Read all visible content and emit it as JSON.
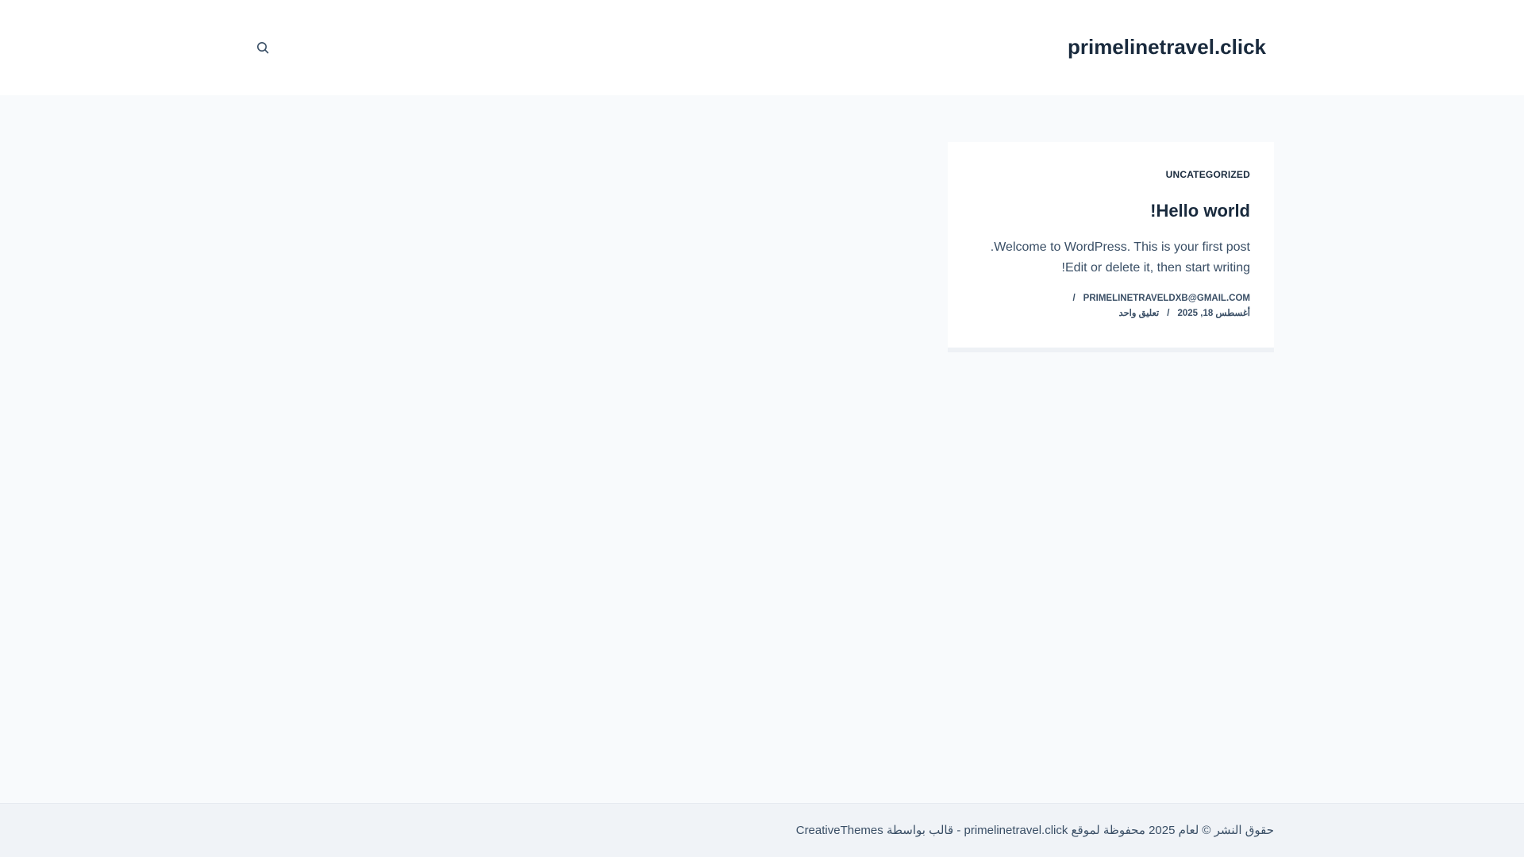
{
  "header": {
    "site_title": "primelinetravel.click",
    "search_icon": "search-icon"
  },
  "post": {
    "category": "UNCATEGORIZED",
    "title": "Hello world!",
    "excerpt_line1": "Welcome to WordPress. This is your first post.",
    "excerpt_line2": "Edit or delete it, then start writing!",
    "author": "PRIMELINETRAVELDXB@GMAIL.COM",
    "date": "أغسطس 18, 2025",
    "comments": "تعليق واحد",
    "separator": "/"
  },
  "footer": {
    "copyright": "حقوق النشر © لعام 2025 محفوظة لموقع primelinetravel.click - قالب بواسطة CreativeThemes"
  },
  "colors": {
    "page_bg": "#f8fafc",
    "header_bg": "#ffffff",
    "heading": "#192a3d",
    "text": "#3a4f66",
    "footer_bg": "#f0f3f7"
  }
}
